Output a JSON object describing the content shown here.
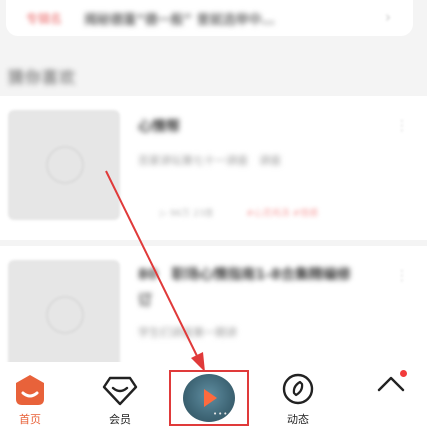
{
  "banner": {
    "tag": "专辑名",
    "text": "揭秘德蓬“德一般” 曾就选举中…",
    "arrow": "›"
  },
  "section_title": "猜你喜欢",
  "cards": [
    {
      "title": "心情帮",
      "subtitle": "百家讲坛第七十一讲座　讲座",
      "meta": "▷ 96万 23首",
      "tag": "#心灵鸡汤 #情感",
      "more": "⋮"
    },
    {
      "title": "80　职场心情指南1-8合集精编修订",
      "subtitle": "学生们讲座第一期讲",
      "meta": "",
      "tag": "",
      "more": "⋮"
    }
  ],
  "tabbar": {
    "home": "首页",
    "vip": "会员",
    "dynamic": "动态",
    "play_dots": "•••"
  },
  "colors": {
    "accent": "#e8623a",
    "highlight_box": "#e03a3a",
    "badge": "#f23b3b"
  }
}
